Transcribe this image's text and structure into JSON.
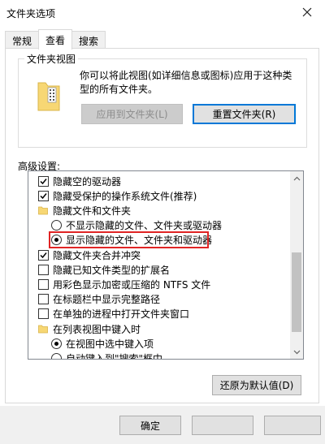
{
  "window": {
    "title": "文件夹选项"
  },
  "tabs": [
    {
      "label": "常规",
      "active": false
    },
    {
      "label": "查看",
      "active": true
    },
    {
      "label": "搜索",
      "active": false
    }
  ],
  "folder_view": {
    "legend": "文件夹视图",
    "description": "你可以将此视图(如详细信息或图标)应用于这种类型的所有文件夹。",
    "apply_button": "应用到文件夹(L)",
    "reset_button": "重置文件夹(R)"
  },
  "advanced": {
    "label": "高级设置:",
    "items": [
      {
        "type": "checkbox",
        "checked": true,
        "label": "隐藏空的驱动器"
      },
      {
        "type": "checkbox",
        "checked": true,
        "label": "隐藏受保护的操作系统文件(推荐)"
      },
      {
        "type": "folder",
        "label": "隐藏文件和文件夹"
      },
      {
        "type": "radio",
        "checked": false,
        "label": "不显示隐藏的文件、文件夹或驱动器"
      },
      {
        "type": "radio",
        "checked": true,
        "label": "显示隐藏的文件、文件夹和驱动器"
      },
      {
        "type": "checkbox",
        "checked": true,
        "label": "隐藏文件夹合并冲突"
      },
      {
        "type": "checkbox",
        "checked": false,
        "label": "隐藏已知文件类型的扩展名"
      },
      {
        "type": "checkbox",
        "checked": false,
        "label": "用彩色显示加密或压缩的 NTFS 文件"
      },
      {
        "type": "checkbox",
        "checked": false,
        "label": "在标题栏中显示完整路径"
      },
      {
        "type": "checkbox",
        "checked": false,
        "label": "在单独的进程中打开文件夹窗口"
      },
      {
        "type": "folder",
        "label": "在列表视图中键入时"
      },
      {
        "type": "radio",
        "checked": true,
        "label": "在视图中选中键入项"
      },
      {
        "type": "radio",
        "checked": false,
        "label": "自动键入到\"搜索\"框中"
      }
    ],
    "restore_button": "还原为默认值(D)"
  },
  "footer": {
    "ok_button": "确定",
    "cancel_button": "",
    "apply_button": ""
  },
  "colors": {
    "accent": "#0078d7",
    "highlight": "#e02424"
  }
}
